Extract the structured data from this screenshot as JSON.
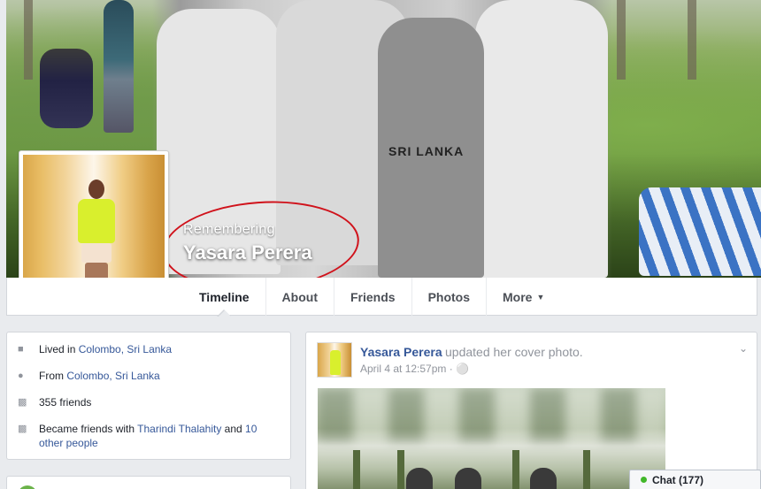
{
  "profile": {
    "memorial_label": "Remembering",
    "name": "Yasara Perera"
  },
  "cover": {
    "shirt_text": "SRI LANKA"
  },
  "nav": {
    "tabs": [
      {
        "label": "Timeline",
        "active": true
      },
      {
        "label": "About",
        "active": false
      },
      {
        "label": "Friends",
        "active": false
      },
      {
        "label": "Photos",
        "active": false
      },
      {
        "label": "More",
        "active": false
      }
    ],
    "more_caret": "▼"
  },
  "intro": {
    "lived": {
      "prefix": "Lived in ",
      "place": "Colombo, Sri Lanka",
      "icon": "house-icon"
    },
    "from": {
      "prefix": "From ",
      "place": "Colombo, Sri Lanka",
      "icon": "location-pin-icon"
    },
    "friends": {
      "text": "355 friends",
      "icon": "friends-icon"
    },
    "became_friends": {
      "prefix": "Became friends with ",
      "person": "Tharindi Thalahity",
      "middle": " and ",
      "others": "10 other people",
      "icon": "friends-icon"
    }
  },
  "post": {
    "author": "Yasara Perera",
    "action": "updated her cover photo.",
    "date": "April 4 at 12:57pm",
    "separator": " · ",
    "privacy_icon": "globe-icon"
  },
  "chat": {
    "label": "Chat (177)",
    "status_color": "#42b72a"
  },
  "colors": {
    "link": "#365899",
    "annotation_circle": "#d0121b",
    "avatar_top": "#d9ef2d"
  }
}
